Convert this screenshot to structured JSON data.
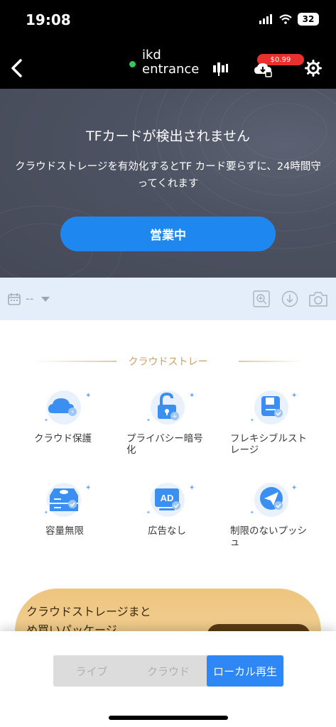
{
  "status_bar": {
    "time": "19:08",
    "battery": "32"
  },
  "header": {
    "title_line1": "ikd",
    "title_line2": "entrance",
    "price_badge": "$0.99",
    "icons": [
      "back-icon",
      "signal-bars-icon",
      "cloud-download-icon",
      "gear-icon"
    ]
  },
  "banner": {
    "title": "TFカードが検出されません",
    "desc_line1": "クラウドストレージを有効化するとTF カード要らずに、24時間守",
    "desc_line2": "ってくれます",
    "button_label": "営業中"
  },
  "toolbar": {
    "date_value": "--",
    "icons": [
      "calendar-icon",
      "chevron-down-icon",
      "zoom-icon",
      "download-icon",
      "camera-icon"
    ]
  },
  "cloud_section": {
    "title": "クラウドストレー",
    "features": [
      {
        "line1": "クラウド保護",
        "line2": "",
        "icon": "cloud-icon"
      },
      {
        "line1": "プライバシー暗号",
        "line2": "化",
        "icon": "unlock-icon"
      },
      {
        "line1": "フレキシブルスト",
        "line2": "レージ",
        "icon": "save-icon"
      },
      {
        "line1": "容量無限",
        "line2": "",
        "icon": "storage-icon"
      },
      {
        "line1": "広告なし",
        "line2": "",
        "icon": "ad-icon"
      },
      {
        "line1": "制限のないプッシ",
        "line2": "ュ",
        "icon": "send-icon"
      }
    ]
  },
  "package": {
    "title_line1": "クラウドストレージまと",
    "title_line2": "め買いパッケージ"
  },
  "bottom_tabs": {
    "items": [
      "ライブ",
      "クラウド",
      "ローカル再生"
    ],
    "active_index": 2
  },
  "colors": {
    "accent": "#2f86f5",
    "cta": "#1e88f0",
    "price_badge": "#e8312f",
    "online_dot": "#34c759",
    "section_title": "#c9a066"
  }
}
